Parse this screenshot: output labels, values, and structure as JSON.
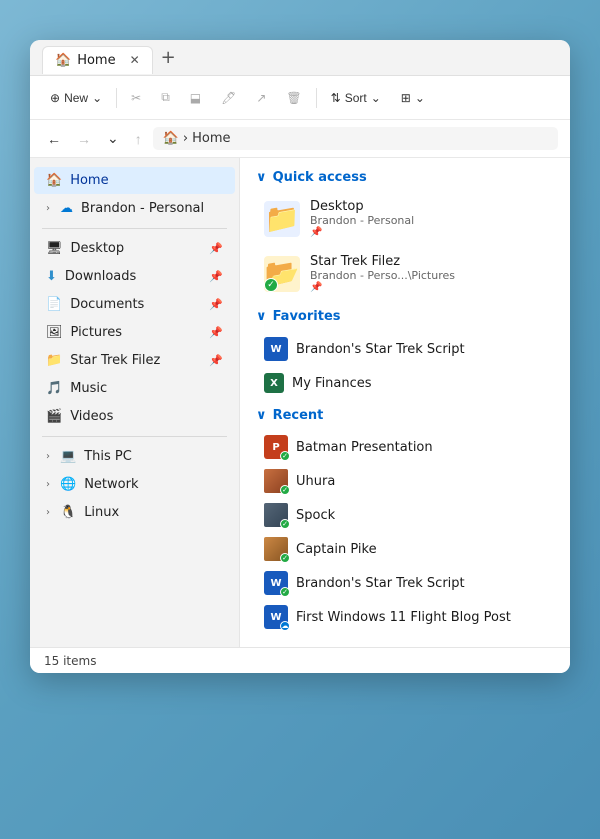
{
  "window": {
    "title": "Home",
    "tab_label": "Home",
    "tab_close": "✕",
    "tab_add": "+"
  },
  "toolbar": {
    "new_label": "New",
    "cut_icon": "✂",
    "copy_icon": "⧉",
    "paste_icon": "📋",
    "rename_icon": "🖊",
    "share_icon": "↗",
    "delete_icon": "🗑",
    "sort_label": "Sort",
    "view_icon": "⊞"
  },
  "addressbar": {
    "back": "←",
    "forward": "→",
    "dropdown": "⌄",
    "up": "↑",
    "home_icon": "🏠",
    "separator": "›",
    "path": "Home"
  },
  "sidebar": {
    "home_label": "Home",
    "onedrive_label": "Brandon - Personal",
    "items": [
      {
        "icon": "🖥",
        "label": "Desktop",
        "pin": true
      },
      {
        "icon": "⬇",
        "label": "Downloads",
        "pin": true
      },
      {
        "icon": "📄",
        "label": "Documents",
        "pin": true
      },
      {
        "icon": "🖼",
        "label": "Pictures",
        "pin": true
      },
      {
        "icon": "📁",
        "label": "Star Trek Filez",
        "pin": true
      },
      {
        "icon": "🎵",
        "label": "Music",
        "pin": false
      },
      {
        "icon": "🎬",
        "label": "Videos",
        "pin": false
      }
    ],
    "system_items": [
      {
        "icon": "💻",
        "label": "This PC"
      },
      {
        "icon": "🌐",
        "label": "Network"
      },
      {
        "icon": "🐧",
        "label": "Linux"
      }
    ]
  },
  "quick_access": {
    "header": "Quick access",
    "items": [
      {
        "icon": "📁",
        "color": "#3090e0",
        "title": "Desktop",
        "sub": "Brandon - Personal",
        "pin": true
      },
      {
        "icon": "📂",
        "color": "#f0a020",
        "title": "Star Trek Filez",
        "sub": "Brandon - Perso...\\Pictures",
        "pin": true,
        "check": true
      }
    ]
  },
  "favorites": {
    "header": "Favorites",
    "items": [
      {
        "icon": "W",
        "type": "word",
        "label": "Brandon's Star Trek Script"
      },
      {
        "icon": "X",
        "type": "excel",
        "label": "My Finances"
      }
    ]
  },
  "recent": {
    "header": "Recent",
    "items": [
      {
        "icon": "P",
        "type": "ppt",
        "label": "Batman Presentation",
        "status": "check"
      },
      {
        "icon": "img",
        "type": "img",
        "label": "Uhura",
        "img_class": "img-uhura",
        "status": "check"
      },
      {
        "icon": "img",
        "type": "img",
        "label": "Spock",
        "img_class": "img-spock",
        "status": "check"
      },
      {
        "icon": "img",
        "type": "img",
        "label": "Captain Pike",
        "img_class": "img-pike",
        "status": "check"
      },
      {
        "icon": "W",
        "type": "word",
        "label": "Brandon's Star Trek Script",
        "status": "check"
      },
      {
        "icon": "W",
        "type": "word",
        "label": "First Windows 11 Flight Blog Post",
        "status": "cloud"
      }
    ]
  },
  "statusbar": {
    "text": "15 items"
  }
}
